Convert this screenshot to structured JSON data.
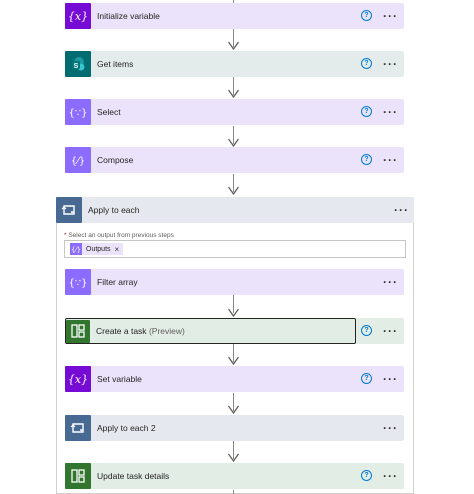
{
  "steps": [
    {
      "title": "Initialize variable",
      "icon": "variable-icon"
    },
    {
      "title": "Get items",
      "icon": "sharepoint-icon"
    },
    {
      "title": "Select",
      "icon": "data-operation-icon"
    },
    {
      "title": "Compose",
      "icon": "data-operation-icon"
    }
  ],
  "apply_each": {
    "title": "Apply to each",
    "field_label_required": "*",
    "field_label": "Select an output from previous steps",
    "token_label": "Outputs",
    "token_remove": "×",
    "inner_steps": [
      {
        "title": "Filter array",
        "icon": "data-operation-icon"
      },
      {
        "title": "Create a task",
        "preview": "(Preview)",
        "icon": "planner-icon",
        "selected": true
      },
      {
        "title": "Set variable",
        "icon": "variable-icon"
      },
      {
        "title": "Apply to each 2",
        "icon": "loop-icon"
      },
      {
        "title": "Update task details",
        "icon": "planner-icon"
      }
    ]
  },
  "common": {
    "help_glyph": "?",
    "more_glyph": "···"
  },
  "colors": {
    "variable": "#770bd6",
    "data_operation": "#8c6cff",
    "sharepoint": "#036c70",
    "apply_to_each": "#486991",
    "planner": "#31752f",
    "help": "#0078d4"
  }
}
